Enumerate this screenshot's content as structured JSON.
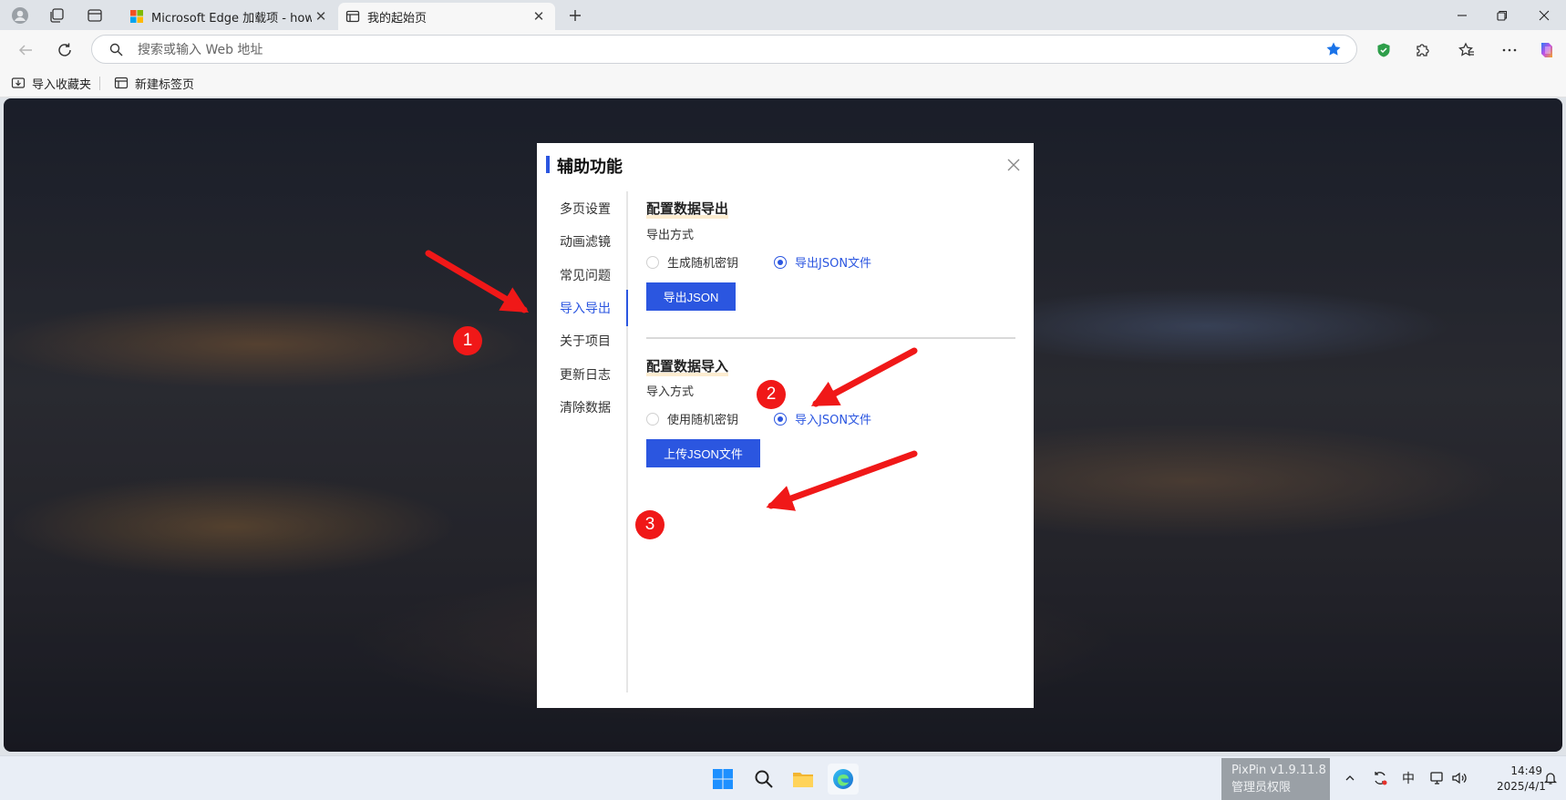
{
  "tabs": [
    {
      "label": "Microsoft Edge 加载项 - howdz起",
      "active": false
    },
    {
      "label": "我的起始页",
      "active": true
    }
  ],
  "address_bar": {
    "placeholder": "搜索或输入 Web 地址"
  },
  "favorites": [
    {
      "label": "导入收藏夹"
    },
    {
      "label": "新建标签页"
    }
  ],
  "dialog": {
    "title": "辅助功能",
    "sidebar": [
      "多页设置",
      "动画滤镜",
      "常见问题",
      "导入导出",
      "关于项目",
      "更新日志",
      "清除数据"
    ],
    "active_index": 3,
    "export": {
      "title": "配置数据导出",
      "method_label": "导出方式",
      "options": [
        "生成随机密钥",
        "导出JSON文件"
      ],
      "selected": 1,
      "button": "导出JSON"
    },
    "import": {
      "title": "配置数据导入",
      "method_label": "导入方式",
      "options": [
        "使用随机密钥",
        "导入JSON文件"
      ],
      "selected": 1,
      "button": "上传JSON文件"
    }
  },
  "annotations": [
    "1",
    "2",
    "3"
  ],
  "annotation_color": "#f01818",
  "accent_color": "#2b56e0",
  "taskbar": {
    "pixpin_line1": "PixPin v1.9.11.8",
    "pixpin_line2": "管理员权限",
    "ime": "中",
    "time": "14:49",
    "date": "2025/4/1"
  }
}
